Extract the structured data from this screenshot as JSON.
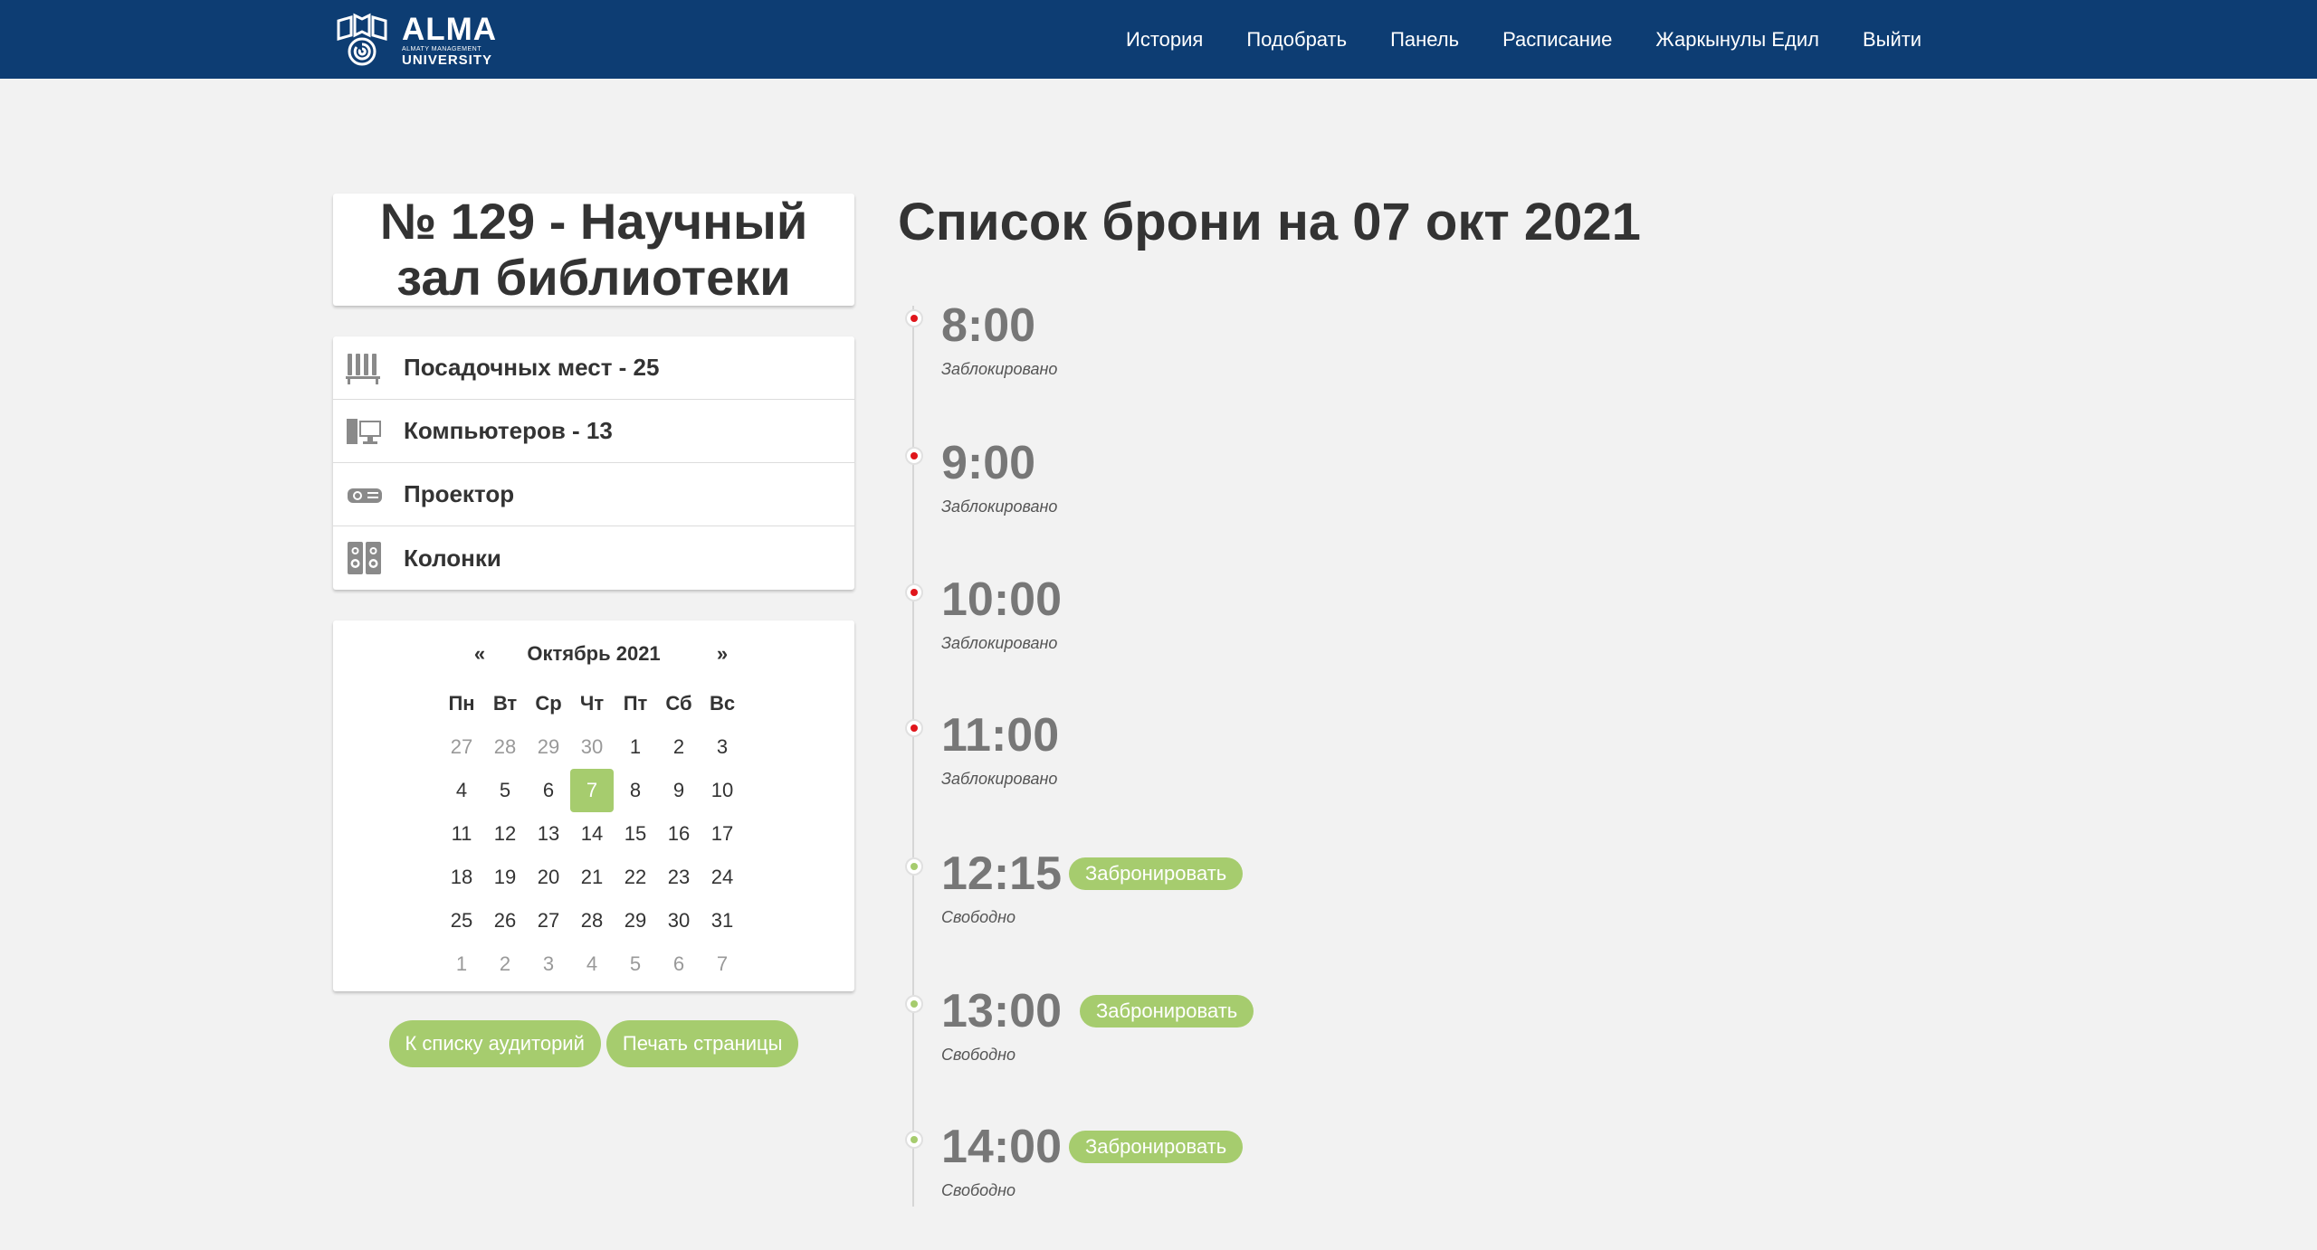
{
  "nav": {
    "logo": {
      "name": "ALMA",
      "subline": "ALMATY MANAGEMENT",
      "university": "UNIVERSITY"
    },
    "items": [
      {
        "label": "История"
      },
      {
        "label": "Подобрать"
      },
      {
        "label": "Панель"
      },
      {
        "label": "Расписание"
      },
      {
        "label": "Жаркынулы Едил"
      },
      {
        "label": "Выйти"
      }
    ]
  },
  "room": {
    "title": "№ 129 - Научный зал библиотеки",
    "features": [
      {
        "icon": "seats-icon",
        "label": "Посадочных мест - 25"
      },
      {
        "icon": "computer-icon",
        "label": "Компьютеров - 13"
      },
      {
        "icon": "projector-icon",
        "label": "Проектор"
      },
      {
        "icon": "speakers-icon",
        "label": "Колонки"
      }
    ]
  },
  "calendar": {
    "prev": "«",
    "next": "»",
    "month": "Октябрь 2021",
    "weekdays": [
      "Пн",
      "Вт",
      "Ср",
      "Чт",
      "Пт",
      "Сб",
      "Вс"
    ],
    "days": [
      {
        "d": "27",
        "m": true
      },
      {
        "d": "28",
        "m": true
      },
      {
        "d": "29",
        "m": true
      },
      {
        "d": "30",
        "m": true
      },
      {
        "d": "1"
      },
      {
        "d": "2"
      },
      {
        "d": "3"
      },
      {
        "d": "4"
      },
      {
        "d": "5"
      },
      {
        "d": "6"
      },
      {
        "d": "7",
        "a": true
      },
      {
        "d": "8"
      },
      {
        "d": "9"
      },
      {
        "d": "10"
      },
      {
        "d": "11"
      },
      {
        "d": "12"
      },
      {
        "d": "13"
      },
      {
        "d": "14"
      },
      {
        "d": "15"
      },
      {
        "d": "16"
      },
      {
        "d": "17"
      },
      {
        "d": "18"
      },
      {
        "d": "19"
      },
      {
        "d": "20"
      },
      {
        "d": "21"
      },
      {
        "d": "22"
      },
      {
        "d": "23"
      },
      {
        "d": "24"
      },
      {
        "d": "25"
      },
      {
        "d": "26"
      },
      {
        "d": "27"
      },
      {
        "d": "28"
      },
      {
        "d": "29"
      },
      {
        "d": "30"
      },
      {
        "d": "31"
      },
      {
        "d": "1",
        "m": true
      },
      {
        "d": "2",
        "m": true
      },
      {
        "d": "3",
        "m": true
      },
      {
        "d": "4",
        "m": true
      },
      {
        "d": "5",
        "m": true
      },
      {
        "d": "6",
        "m": true
      },
      {
        "d": "7",
        "m": true
      }
    ]
  },
  "buttons": {
    "back_to_list": "К списку аудиторий",
    "print_page": "Печать страницы"
  },
  "schedule": {
    "title": "Список брони на 07 окт 2021",
    "book_label": "Забронировать",
    "slots": [
      {
        "time": "8:00",
        "status": "Заблокировано",
        "state": "blocked"
      },
      {
        "time": "9:00",
        "status": "Заблокировано",
        "state": "blocked"
      },
      {
        "time": "10:00",
        "status": "Заблокировано",
        "state": "blocked"
      },
      {
        "time": "11:00",
        "status": "Заблокировано",
        "state": "blocked"
      },
      {
        "time": "12:15",
        "status": "Свободно",
        "state": "free"
      },
      {
        "time": "13:00",
        "status": "Свободно",
        "state": "free"
      },
      {
        "time": "14:00",
        "status": "Свободно",
        "state": "free"
      }
    ]
  },
  "colors": {
    "navbar": "#0d3d73",
    "accent_green": "#a6cc6e",
    "blocked_red": "#e0151b",
    "background": "#f2f2f2"
  }
}
